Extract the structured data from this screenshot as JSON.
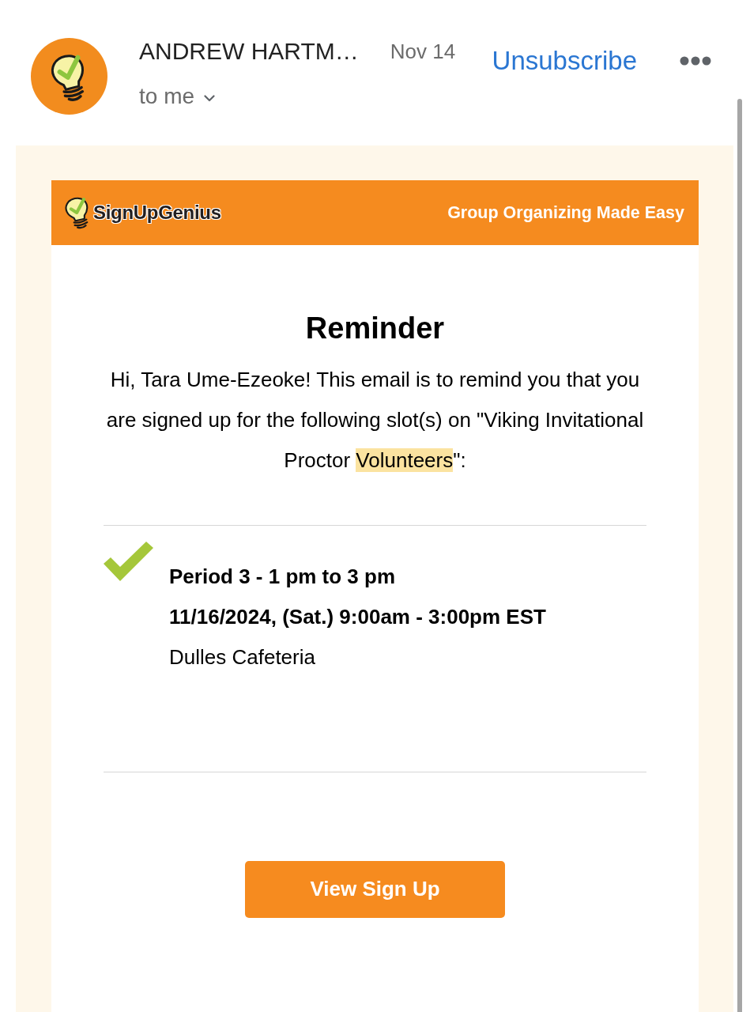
{
  "sender": {
    "name": "ANDREW HARTM…",
    "date": "Nov 14",
    "recipient": "to me"
  },
  "actions": {
    "unsubscribe": "Unsubscribe"
  },
  "email": {
    "banner": {
      "brand": "SignUpGenius",
      "tagline": "Group Organizing Made Easy"
    },
    "title": "Reminder",
    "intro": [
      {
        "text": "Hi, Tara Ume-Ezeoke! This email is to remind you that you are signed up for the following slot(s) on \"Viking Invitational Proctor ",
        "highlighted": false
      },
      {
        "text": "Volunteers",
        "highlighted": true
      },
      {
        "text": "\":",
        "highlighted": false
      }
    ],
    "slots": [
      {
        "title": "Period 3 - 1 pm to 3 pm",
        "when": "11/16/2024, (Sat.) 9:00am - 3:00pm EST",
        "location": "Dulles Cafeteria"
      }
    ],
    "button": "View Sign Up"
  }
}
